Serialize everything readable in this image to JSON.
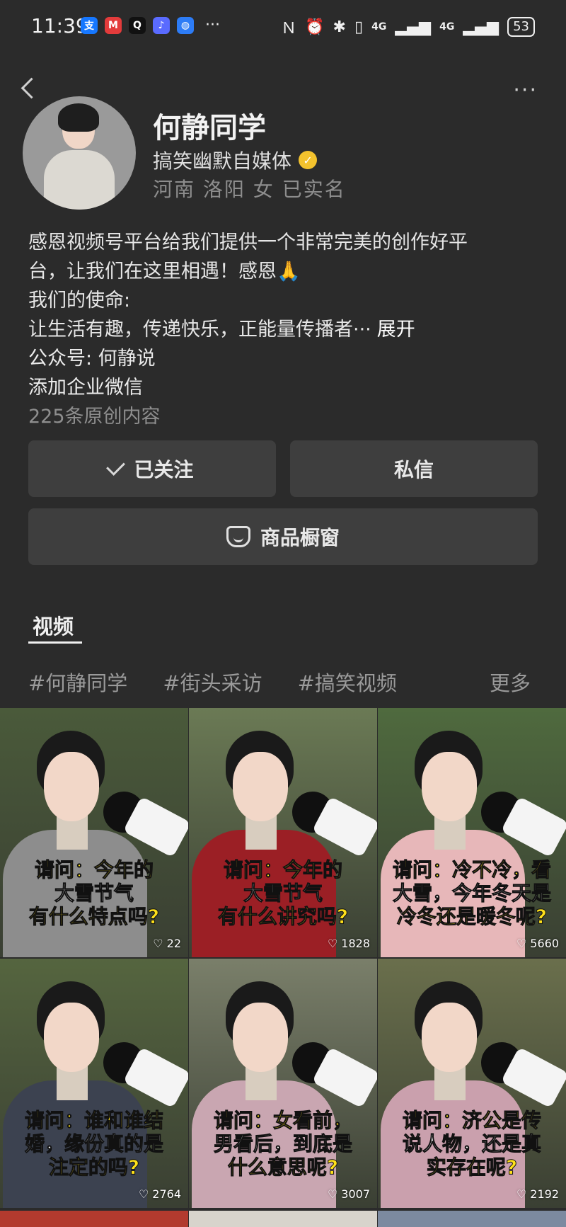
{
  "status_bar": {
    "time": "11:39",
    "battery": "53",
    "more": "···",
    "network1": "4G",
    "network2": "4G"
  },
  "header": {
    "more": "···"
  },
  "profile": {
    "name": "何静同学",
    "category": "搞笑幽默自媒体",
    "location": "河南 洛阳 女 已实名"
  },
  "bio": {
    "line1": "感恩视频号平台给我们提供一个非常完美的创作好平",
    "line2": "台，让我们在这里相遇！感恩🙏",
    "line3": "我们的使命:",
    "line4": "让生活有趣，传递快乐，正能量传播者···",
    "expand": "展开",
    "official_account": "公众号: 何静说",
    "wechat_work": "添加企业微信",
    "original_count": "225条原创内容"
  },
  "actions": {
    "follow": "已关注",
    "message": "私信",
    "shop": "商品橱窗"
  },
  "tabs": {
    "video": "视频"
  },
  "hashtags": {
    "items": [
      "#何静同学",
      "#街头采访",
      "#搞笑视频"
    ],
    "more": "更多"
  },
  "videos": [
    {
      "lines": [
        "请问：今年的",
        "大雪节气",
        "有什么特点吗?"
      ],
      "likes": "22",
      "coat": "#8d8d8d",
      "bg": "#4a5a3a"
    },
    {
      "lines": [
        "请问：今年的",
        "大雪节气",
        "有什么讲究吗?"
      ],
      "likes": "1828",
      "coat": "#9b1f25",
      "bg": "#6b7a55"
    },
    {
      "lines": [
        "请问：冷不冷，看",
        "大雪，今年冬天是",
        "冷冬还是暖冬呢?"
      ],
      "likes": "5660",
      "coat": "#e7b7b9",
      "bg": "#4f6a3e"
    },
    {
      "lines": [
        "请问：谁和谁结",
        "婚，缘份真的是",
        "注定的吗?"
      ],
      "likes": "2764",
      "coat": "#3c4250",
      "bg": "#55653f"
    },
    {
      "lines": [
        "请问：女看前，",
        "男看后，到底是",
        "什么意思呢?"
      ],
      "likes": "3007",
      "coat": "#c9a6b1",
      "bg": "#7a7f6a"
    },
    {
      "lines": [
        "请问：济公是传",
        "说人物，还是真",
        "实存在呢?"
      ],
      "likes": "2192",
      "coat": "#caa0ad",
      "bg": "#6a6f4c"
    }
  ],
  "colors": {
    "background": "#2b2b2b",
    "button": "#3e3e3e",
    "verified": "#f3c22d",
    "caption_yellow": "#ffe11a"
  }
}
